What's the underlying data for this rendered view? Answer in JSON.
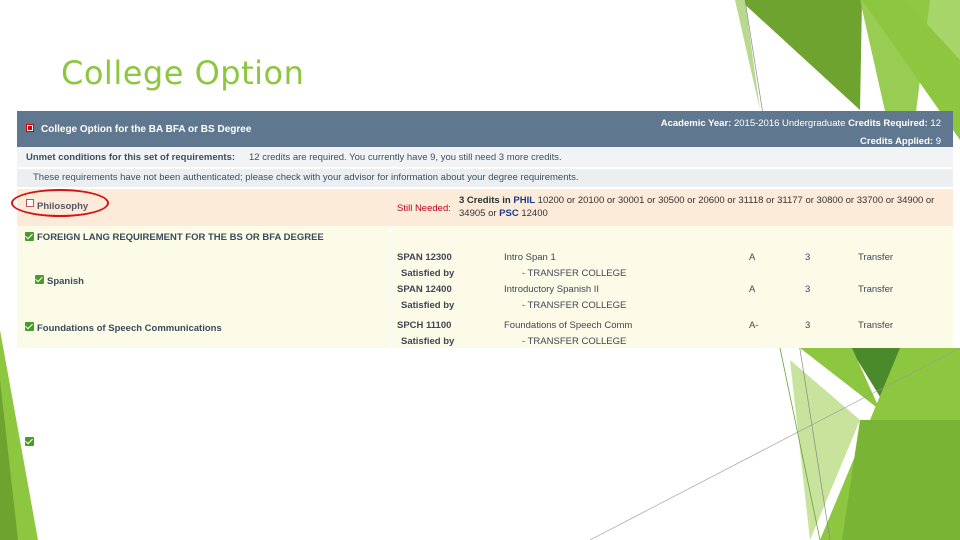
{
  "slide": {
    "title": "College Option",
    "accent_colors": [
      "#8dc63f",
      "#6ea32f",
      "#a8d56a",
      "#4a8a2a"
    ]
  },
  "header": {
    "title": "College Option for the BA BFA or BS Degree",
    "academic_year_label": "Academic Year:",
    "academic_year_value": "2015-2016 Undergraduate",
    "credits_required_label": "Credits Required:",
    "credits_required_value": "12",
    "credits_applied_label": "Credits Applied:",
    "credits_applied_value": "9"
  },
  "unmet": {
    "label": "Unmet conditions for this set of requirements:",
    "text": "12 credits are required. You currently have 9, you still need 3 more credits."
  },
  "auth_notice": "These requirements have not been authenticated; please check with your advisor for information about your degree requirements.",
  "philosophy": {
    "label": "Philosophy",
    "still_needed_label": "Still Needed:",
    "credits": "3 Credits in",
    "subject": "PHIL",
    "courses": "10200 or 20100 or 30001 or 30500 or 20600 or 31118 or 31177 or 30800 or 33700 or 34900 or 34905",
    "or_word": "or",
    "subject2": "PSC",
    "course2": "12400"
  },
  "foreign_lang": {
    "label": "FOREIGN LANG REQUIREMENT FOR THE BS OR BFA DEGREE",
    "spanish_label": "Spanish",
    "speech_label": "Foundations of Speech Communications",
    "courses": [
      {
        "code": "SPAN 12300",
        "title": "Intro Span 1",
        "grade": "A",
        "credits": "3",
        "type": "Transfer",
        "satisfied": "Satisfied by",
        "source": "- TRANSFER COLLEGE"
      },
      {
        "code": "SPAN 12400",
        "title": "Introductory Spanish II",
        "grade": "A",
        "credits": "3",
        "type": "Transfer",
        "satisfied": "Satisfied by",
        "source": "- TRANSFER COLLEGE"
      },
      {
        "code": "SPCH 11100",
        "title": "Foundations of Speech Comm",
        "grade": "A-",
        "credits": "3",
        "type": "Transfer",
        "satisfied": "Satisfied by",
        "source": "- TRANSFER COLLEGE"
      }
    ]
  }
}
